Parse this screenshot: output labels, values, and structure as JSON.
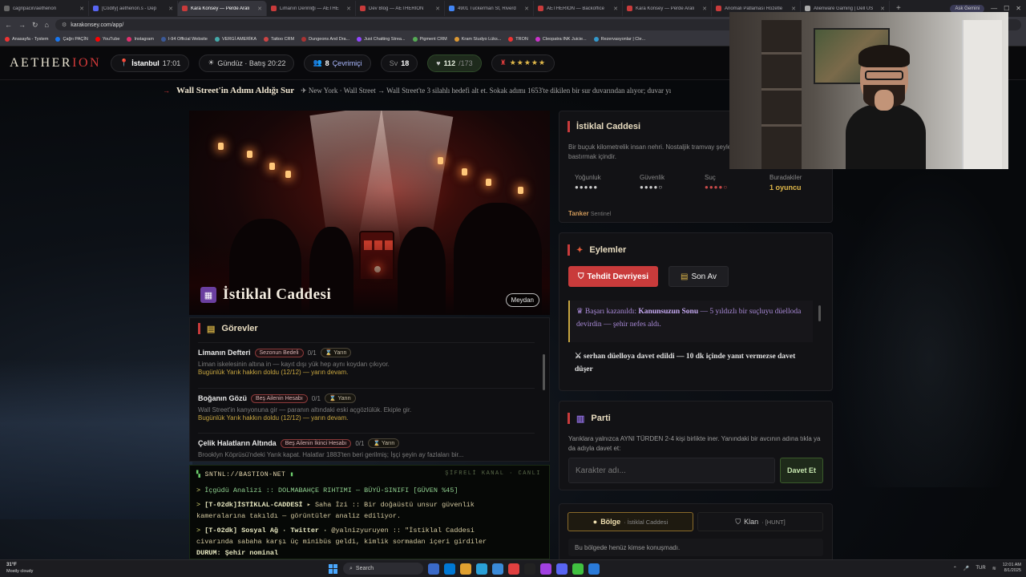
{
  "browser": {
    "tabs": [
      {
        "title": "cagripacin/aetherion",
        "color": "#666"
      },
      {
        "title": "[Codify] aetherion.s - Dep",
        "color": "#5865f2"
      },
      {
        "title": "Kara Konsey — Perde Aralı",
        "color": "#c93b3b",
        "active": true
      },
      {
        "title": "Limanın Derinliği — AETHE",
        "color": "#c93b3b"
      },
      {
        "title": "Dev Blog — AETHERION",
        "color": "#c93b3b"
      },
      {
        "title": "4901 Tuckerman St, Riverd",
        "color": "#4285f4"
      },
      {
        "title": "AETHERION — Backoffice",
        "color": "#c93b3b"
      },
      {
        "title": "Kara Konsey — Perde Aralı",
        "color": "#c93b3b"
      },
      {
        "title": "Anomali Patlaması Rozetle",
        "color": "#c93b3b"
      },
      {
        "title": "Alienware Gaming | Dell US",
        "color": "#aaa"
      }
    ],
    "new_tab": "+",
    "gemini": "Ask Gemini",
    "url": "karakonsey.com/app/",
    "bookmarks": [
      {
        "label": "Anasayfa - Tystem",
        "color": "#e33"
      },
      {
        "label": "Çağrı PAÇİN",
        "color": "#1877f2"
      },
      {
        "label": "YouTube",
        "color": "#f00"
      },
      {
        "label": "Instagram",
        "color": "#e1306c"
      },
      {
        "label": "I-94 Official Website",
        "color": "#3b5998"
      },
      {
        "label": "VERGİ AMERİKA",
        "color": "#4aa"
      },
      {
        "label": "Tattoo CRM",
        "color": "#c44"
      },
      {
        "label": "Dungeons And Dra...",
        "color": "#a33"
      },
      {
        "label": "Just Chatting Strea...",
        "color": "#9146ff"
      },
      {
        "label": "Pigment CRM",
        "color": "#5a5"
      },
      {
        "label": "Kram Studyo Lüks...",
        "color": "#d93"
      },
      {
        "label": "TRON",
        "color": "#e33"
      },
      {
        "label": "Cleopatra INK Juicie...",
        "color": "#c3c"
      },
      {
        "label": "Rezervasyonlar | Cle...",
        "color": "#39c"
      }
    ]
  },
  "nav": {
    "logo_main": "AETHER",
    "logo_accent": "ION",
    "city": "İstanbul",
    "time": "17:01",
    "daylight": "Gündüz · Batış 20:22",
    "online_count": "8",
    "online_label": "Çevrimiçi",
    "level_label": "Sv",
    "level": "18",
    "hp": "112",
    "hp_max": "/173",
    "rank_stars": "★★★★★"
  },
  "ticker": {
    "title": "Wall Street'in Adımı Aldığı Sur",
    "text": "✈ New York · Wall Street → Wall Street'te 3 silahlı hedefi alt et. Sokak adımı 1653'te dikilen bir sur duvarından alıyor; duvar yı"
  },
  "hero": {
    "location_name": "İstiklal Caddesi",
    "type_badge": "Meydan"
  },
  "gorevler": {
    "title": "Görevler",
    "quests": [
      {
        "name": "Limanın Defteri",
        "tag": "Sezonun Bedeli",
        "count": "0/1",
        "status": "Yarın",
        "desc": "Liman iskelesinin altına in — kayıt dışı yük hep aynı koydan çıkıyor.",
        "warn": "Bugünlük Yarık hakkın doldu (12/12) — yarın devam."
      },
      {
        "name": "Boğanın Gözü",
        "tag": "Beş Ailenin Hesabı",
        "count": "0/1",
        "status": "Yarın",
        "desc": "Wall Street'in kanyonuna gir — paranın altındaki eski açgözlülük. Ekiple gir.",
        "warn": "Bugünlük Yarık hakkın doldu (12/12) — yarın devam."
      },
      {
        "name": "Çelik Halatların Altında",
        "tag": "Beş Ailenin İkinci Hesabı",
        "count": "0/1",
        "status": "Yarın",
        "desc": "Brooklyn Köprüsü'ndeki Yarık kapat. Halatlar 1883'ten beri gerilmiş; İşçi şeyin ay fazlaları bir...",
        "warn": ""
      }
    ]
  },
  "terminal": {
    "host": "SNTNL://BASTION-NET",
    "status": "ŞİFRELİ KANAL · CANLI",
    "lines": [
      {
        "a": "İçgüdü Analizi",
        "b": ":: DOLMABAHÇE RIHTIMI — BÜYÜ-SINIFI [GÜVEN %45]"
      },
      {
        "a": "[T-02dk]İSTİKLAL-CADDESİ",
        "b": "▸ Saha İzi :: Bir doğaüstü unsur güvenlik"
      },
      {
        "a": "",
        "b": "kameralarına takıldı — görüntüler analiz ediliyor."
      },
      {
        "a": "[T-02dk] Sosyal Ağ · Twitter ·",
        "b": "@yalnizyuruyen :: \"İstiklal Caddesi"
      },
      {
        "a": "",
        "b": "civarında sabaha karşı üç minibüs geldi, kimlik sormadan içeri girdiler"
      },
      {
        "a": "DURUM: Şehir nominal",
        "b": ""
      }
    ]
  },
  "location_card": {
    "title": "İstiklal Caddesi",
    "desc": "Bir buçuk kilometrelik insan nehri. Nostaljik tramvay şeyleri bastırmak içindir.",
    "stats": [
      {
        "label": "Yoğunluk",
        "value": "●●●●●"
      },
      {
        "label": "Güvenlik",
        "value": "●●●●○"
      },
      {
        "label": "Suç",
        "value": "●●●●○"
      },
      {
        "label": "Buradakiler",
        "value": "1 oyuncu"
      }
    ],
    "faction": "Tanker",
    "faction_sub": "Sentinel"
  },
  "eylemler": {
    "title": "Eylemler",
    "btn_primary": "Tehdit Devriyesi",
    "btn_secondary": "Son Av",
    "log_success_prefix": "Başarı kazanıldı:",
    "log_success_name": "Kanunsuzun Sonu",
    "log_success_rest": "— 5 yıldızlı bir suçluyu düelloda devirdin — şehir nefes aldı.",
    "log_duel": "⚔ serhan düelloya davet edildi — 10 dk içinde yanıt vermezse davet düşer"
  },
  "parti": {
    "title": "Parti",
    "desc": "Yarıklara yalnızca AYNI TÜRDEN 2-4 kişi birlikte iner. Yanındaki bir avcının adına tıkla ya da adıyla davet et:",
    "placeholder": "Karakter adı...",
    "invite": "Davet Et"
  },
  "chat": {
    "tab_region": "Bölge",
    "tab_region_sub": "· İstiklal Caddesi",
    "tab_clan": "Klan",
    "tab_clan_sub": "· [HUNT]",
    "empty": "Bu bölgede henüz kimse konuşmadı."
  },
  "taskbar": {
    "temp": "31°F",
    "weather": "Mostly cloudy",
    "search": "Search",
    "lang": "TUR",
    "time": "12:01 AM",
    "date": "8/1/2025"
  }
}
